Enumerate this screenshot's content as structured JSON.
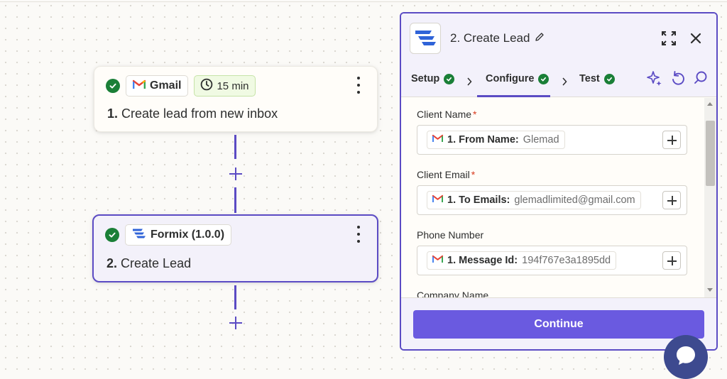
{
  "canvas": {
    "steps": [
      {
        "app": "Gmail",
        "delay": "15 min",
        "number": "1.",
        "title": "Create lead from new inbox"
      },
      {
        "app": "Formix (1.0.0)",
        "number": "2.",
        "title": "Create Lead"
      }
    ]
  },
  "panel": {
    "title": "2. Create Lead",
    "tabs": [
      {
        "label": "Setup",
        "complete": true
      },
      {
        "label": "Configure",
        "complete": true,
        "active": true
      },
      {
        "label": "Test",
        "complete": true
      }
    ],
    "fields": [
      {
        "label": "Client Name",
        "required": "*",
        "source": "1. From Name:",
        "value": "Glemad"
      },
      {
        "label": "Client Email",
        "required": "*",
        "source": "1. To Emails:",
        "value": "glemadlimited@gmail.com"
      },
      {
        "label": "Phone Number",
        "required": "",
        "source": "1. Message Id:",
        "value": "194f767e3a1895dd"
      },
      {
        "label": "Company Name"
      }
    ],
    "continue_label": "Continue"
  },
  "colors": {
    "accent": "#5b4bc4",
    "button": "#6a5ae0",
    "success": "#1a7f37",
    "required": "#d93b1f",
    "chat": "#3d4a8f"
  },
  "icons": [
    "check-circle-icon",
    "gmail-icon",
    "clock-icon",
    "kebab-menu-icon",
    "formix-logo-icon",
    "pencil-icon",
    "expand-icon",
    "close-icon",
    "chevron-right-icon",
    "sparkle-icon",
    "undo-icon",
    "search-icon",
    "plus-icon",
    "chat-icon"
  ]
}
